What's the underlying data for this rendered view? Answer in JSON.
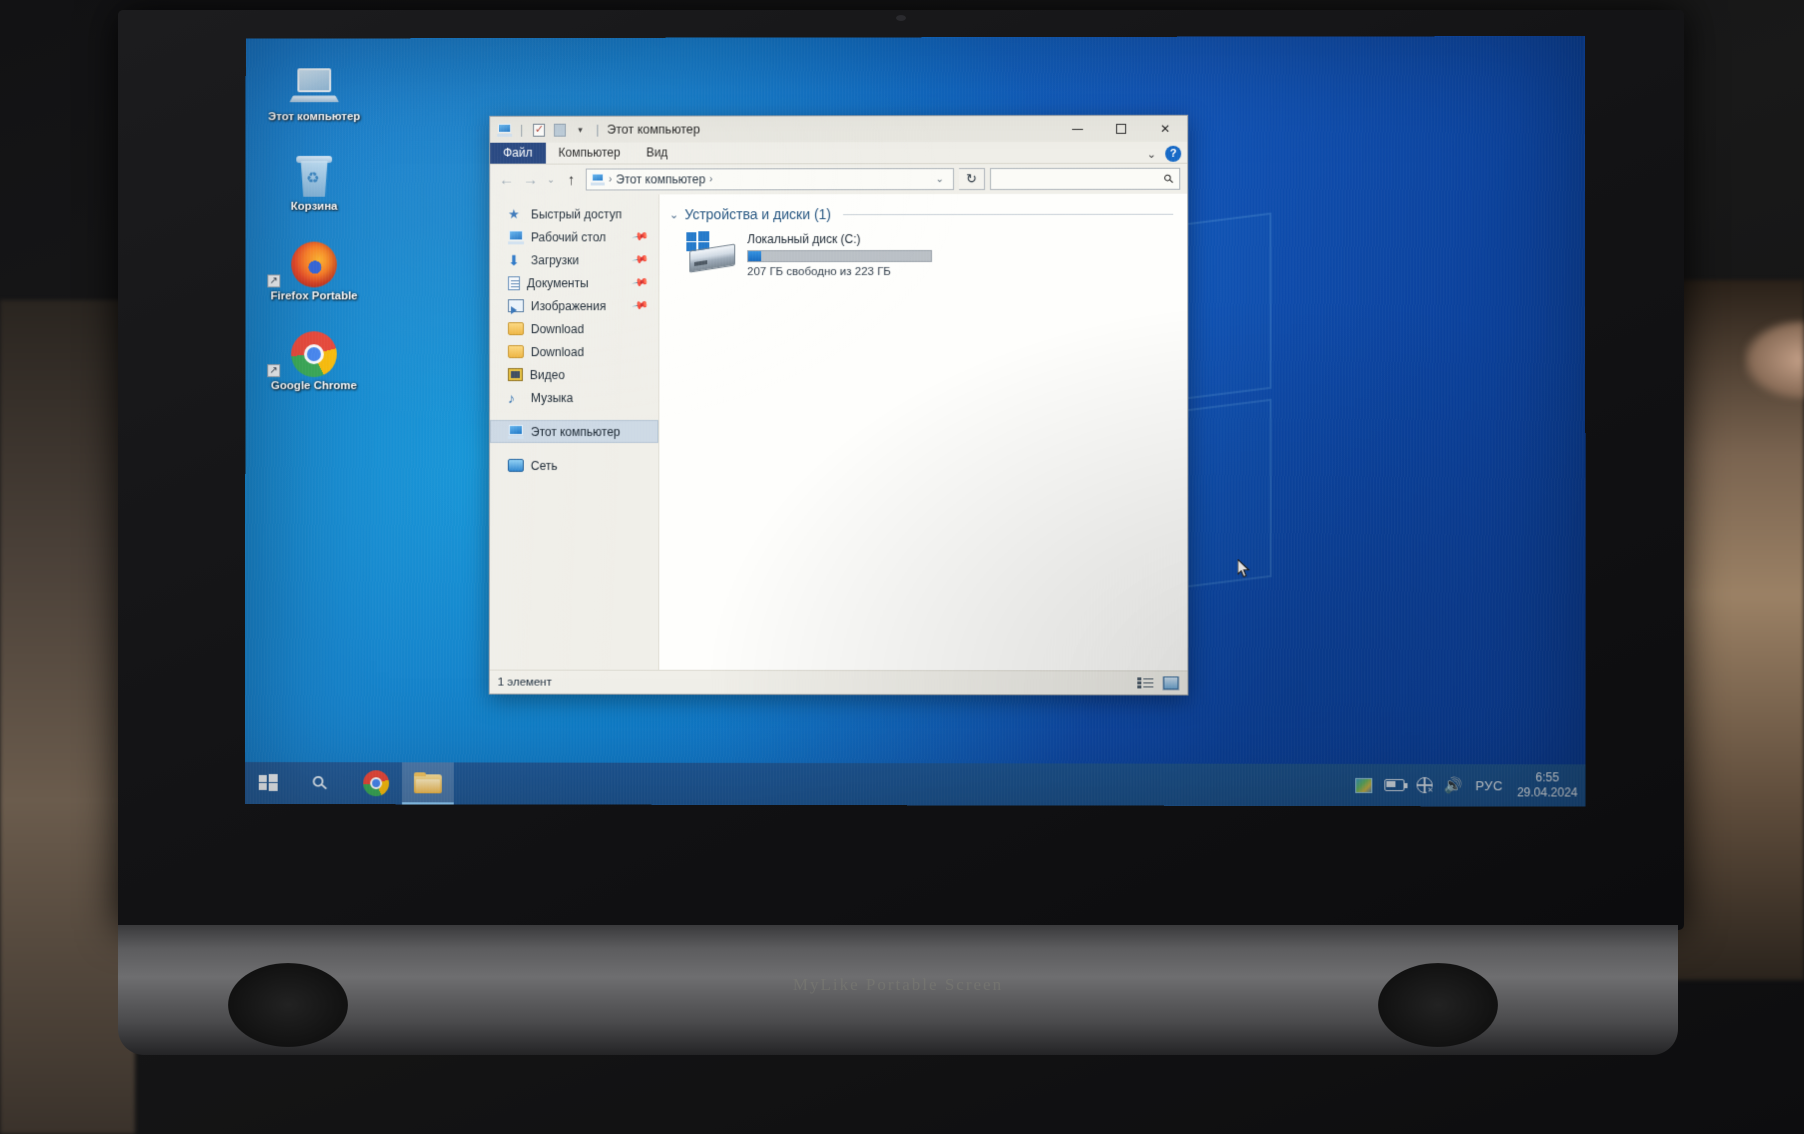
{
  "desktop": {
    "icons": [
      {
        "name": "Этот компьютер",
        "icon": "this-pc-icon",
        "shortcut": false
      },
      {
        "name": "Корзина",
        "icon": "recycle-bin-icon",
        "shortcut": false
      },
      {
        "name": "Firefox Portable",
        "icon": "firefox-icon",
        "shortcut": true
      },
      {
        "name": "Google Chrome",
        "icon": "chrome-icon",
        "shortcut": true
      }
    ]
  },
  "explorer": {
    "title": "Этот компьютер",
    "quick_access_toolbar": [
      {
        "icon": "this-pc-icon"
      },
      {
        "icon": "properties-checkbox-icon"
      },
      {
        "icon": "new-folder-icon"
      },
      {
        "icon": "customize-dropdown-icon"
      }
    ],
    "window_controls": {
      "minimize": "—",
      "maximize": "□",
      "close": "✕",
      "ribbon_toggle": "⌄",
      "help": "?"
    },
    "ribbon_tabs": [
      {
        "label": "Файл",
        "active": true
      },
      {
        "label": "Компьютер",
        "active": false
      },
      {
        "label": "Вид",
        "active": false
      }
    ],
    "navigation": {
      "back": "←",
      "forward": "→",
      "recent": "⌄",
      "up": "↑"
    },
    "address_bar": {
      "crumb_icon": "this-pc-icon",
      "crumbs": [
        "Этот компьютер"
      ],
      "separator": "›",
      "dropdown": "⌄",
      "refresh": "↻"
    },
    "search": {
      "value": "",
      "placeholder": "",
      "icon": "search-icon"
    },
    "nav_pane": [
      {
        "label": "Быстрый доступ",
        "icon": "star-icon",
        "pinned": false,
        "selected": false
      },
      {
        "label": "Рабочий стол",
        "icon": "desktop-icon",
        "pinned": true,
        "selected": false
      },
      {
        "label": "Загрузки",
        "icon": "downloads-icon",
        "pinned": true,
        "selected": false
      },
      {
        "label": "Документы",
        "icon": "documents-icon",
        "pinned": true,
        "selected": false
      },
      {
        "label": "Изображения",
        "icon": "pictures-icon",
        "pinned": true,
        "selected": false
      },
      {
        "label": "Download",
        "icon": "folder-icon",
        "pinned": false,
        "selected": false
      },
      {
        "label": "Download",
        "icon": "folder-icon",
        "pinned": false,
        "selected": false
      },
      {
        "label": "Видео",
        "icon": "video-icon",
        "pinned": false,
        "selected": false
      },
      {
        "label": "Музыка",
        "icon": "music-icon",
        "pinned": false,
        "selected": false
      },
      {
        "label": "Этот компьютер",
        "icon": "this-pc-icon",
        "pinned": false,
        "selected": true
      },
      {
        "label": "Сеть",
        "icon": "network-icon",
        "pinned": false,
        "selected": false
      }
    ],
    "content": {
      "group_header": "Устройства и диски (1)",
      "group_caret": "⌄",
      "drives": [
        {
          "name": "Локальный диск (C:)",
          "free_text": "207 ГБ свободно из 223 ГБ",
          "free_gb": 207,
          "total_gb": 223,
          "used_percent": 7,
          "icon": "local-disk-windows-icon",
          "bar_color": "#1066bd"
        }
      ]
    },
    "status_bar": {
      "item_count": "1 элемент",
      "view_details": "details-view-icon",
      "view_large_icons": "large-icons-view-icon"
    }
  },
  "taskbar": {
    "start": {
      "icon": "windows-start-icon"
    },
    "search": {
      "icon": "search-icon"
    },
    "apps": [
      {
        "icon": "chrome-icon",
        "name": "Google Chrome",
        "active": false
      },
      {
        "icon": "file-explorer-icon",
        "name": "Проводник",
        "active": true
      }
    ],
    "tray": {
      "icons": [
        {
          "icon": "tray-app-icon"
        },
        {
          "icon": "battery-icon"
        },
        {
          "icon": "network-unavailable-icon"
        },
        {
          "icon": "volume-icon"
        }
      ],
      "language": "РУС",
      "time": "6:55",
      "date": "29.04.2024"
    }
  },
  "laptop": {
    "brand_text": "MyLike Portable Screen"
  }
}
